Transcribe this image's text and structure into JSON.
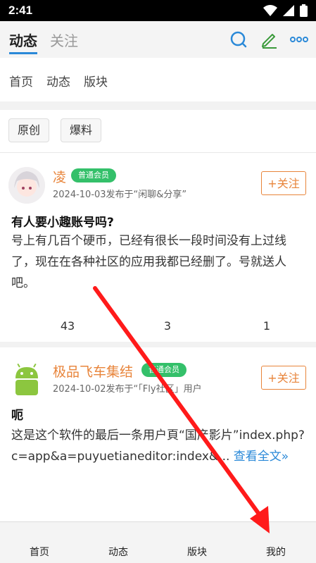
{
  "status": {
    "time": "2:41"
  },
  "header": {
    "tab_active": "动态",
    "tab_inactive": "关注"
  },
  "subnav": {
    "items": [
      "首页",
      "动态",
      "版块"
    ]
  },
  "filters": [
    "原创",
    "爆料"
  ],
  "posts": [
    {
      "username": "凌",
      "badge": "普通会员",
      "meta": "2024-10-03发布于“闲聊&分享”",
      "follow": "+关注",
      "title": "有人要小趣账号吗?",
      "body": "号上有几百个硬币，已经有很长一段时间没有上过线了，现在在各种社区的应用我都已经删了。号就送人吧。",
      "stats": [
        "43",
        "3",
        "1"
      ]
    },
    {
      "username": "极品飞车集结",
      "badge": "普通会员",
      "meta": "2024-10-02发布于“「Fly社区」用户",
      "follow": "+关注",
      "title": "呃",
      "body": "这是这个软件的最后一条用户頁“国产影片”index.php?c=app&a=puyuetianeditor:index&...",
      "more": "查看全文»"
    }
  ],
  "bottom_nav": [
    "首页",
    "动态",
    "版块",
    "我的"
  ],
  "colors": {
    "accent": "#2a89d8",
    "orange": "#e8843a",
    "badge": "#34c06a",
    "arrow": "#ff1a1a"
  }
}
